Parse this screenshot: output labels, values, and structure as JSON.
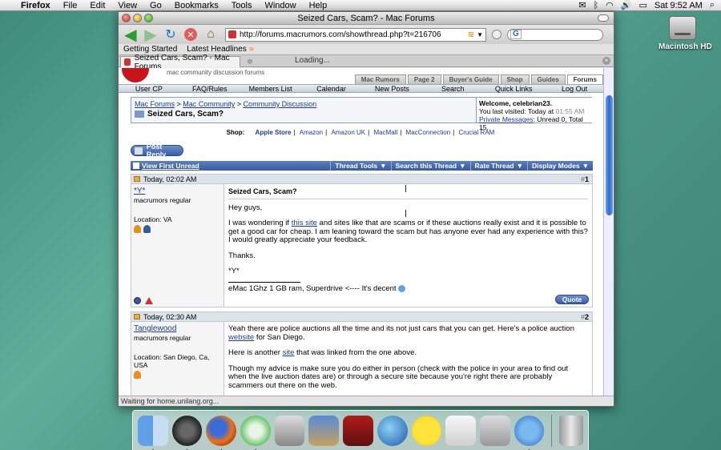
{
  "menubar": {
    "app": "Firefox",
    "items": [
      "File",
      "Edit",
      "View",
      "Go",
      "Bookmarks",
      "Tools",
      "Window",
      "Help"
    ],
    "clock": "Sat 9:52 AM"
  },
  "desktop": {
    "hd_label": "Macintosh HD"
  },
  "window": {
    "title": "Seized Cars, Scam? - Mac Forums",
    "url": "http://forums.macrumors.com/showthread.php?t=216706",
    "search_placeholder": "",
    "bookmarks": [
      "Getting Started",
      "Latest Headlines"
    ],
    "tab_title": "Seized Cars, Scam? - Mac Forums",
    "loading_text": "Loading...",
    "status": "Waiting for home.unilang.org..."
  },
  "site": {
    "tagline": "mac community discussion forums",
    "tabs": [
      "Mac Rumors",
      "Page 2",
      "Buyer's Guide",
      "Shop",
      "Guides",
      "Forums"
    ],
    "forum_nav": [
      "User CP",
      "FAQ/Rules",
      "Members List",
      "Calendar",
      "New Posts",
      "Search",
      "Quick Links",
      "Log Out"
    ]
  },
  "breadcrumb": {
    "crumbs": [
      "Mac Forums",
      "Mac Community",
      "Community Discussion"
    ],
    "current": "Seized Cars, Scam?",
    "welcome": "Welcome, celebrian23.",
    "last_visited_label": "You last visited: Today at",
    "last_visited_time": "01:55 AM",
    "pm_link": "Private Messages",
    "pm_counts": ": Unread 0, Total 15."
  },
  "shop": {
    "label": "Shop:",
    "links": [
      "Apple Store",
      "Amazon",
      "Amazon UK",
      "MacMall",
      "MacConnection",
      "Crucial RAM"
    ]
  },
  "thread": {
    "post_reply": "Post Reply",
    "view_first_unread": "View First Unread",
    "menus": [
      "Thread Tools",
      "Search this Thread",
      "Rate Thread",
      "Display Modes"
    ]
  },
  "posts": [
    {
      "date": "Today, 02:02 AM",
      "num": "1",
      "user": "*Y*",
      "user_title": "macrumors regular",
      "location": "Location: VA",
      "title": "Seized Cars, Scam?",
      "greeting": "Hey guys,",
      "body_pre": "I was wondering if ",
      "body_link": "this site",
      "body_post": " and sites like that are scams or if these auctions really exist and it is possible to get a good car for cheap. I am leaning toward the scam but has anyone ever had any experience with this? I would greatly appreciate your feedback.",
      "thanks": "Thanks.",
      "signoff": "*Y*",
      "signature": "eMac 1Ghz 1 GB ram, Superdrive <---- It's decent",
      "quote": "Quote"
    },
    {
      "date": "Today, 02:30 AM",
      "num": "2",
      "user": "Tanglewood",
      "user_title": "macrumors regular",
      "location": "Location: San Diego, Ca, USA",
      "p1_pre": "Yeah there are police auctions all the time and its not just cars that you can get. Here's a police auction ",
      "p1_link": "website",
      "p1_post": " for San Diego.",
      "p2_pre": "Here is another ",
      "p2_link": "site",
      "p2_post": " that was linked from the one above.",
      "p3": "Though my advice is make sure you do either in person (check with the police in your area to find out when the live auction dates are) or through a secure site because you're right there are probably scammers out there on the web."
    }
  ]
}
